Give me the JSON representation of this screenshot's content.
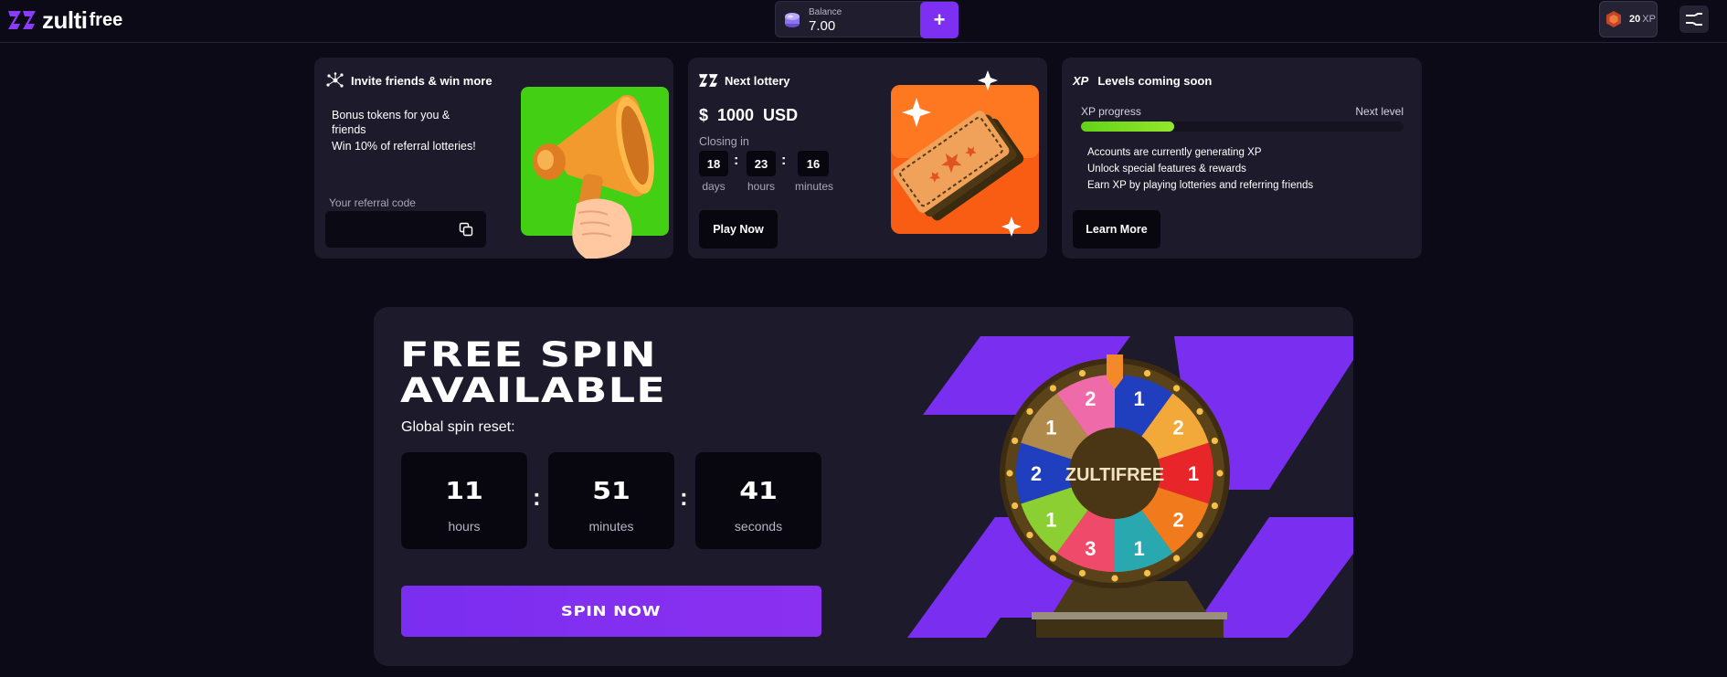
{
  "header": {
    "logo_word": "zulti",
    "logo_free": "free",
    "balance_label": "Balance",
    "balance_value": "7.00",
    "add_label": "+",
    "xp_value": "20",
    "xp_unit": "XP"
  },
  "cards": {
    "invite": {
      "title": "Invite friends & win more",
      "line1": "Bonus tokens for you & friends",
      "line2": "Win 10% of referral lotteries!",
      "ref_label": "Your referral code",
      "ref_value": ""
    },
    "lottery": {
      "title": "Next lottery",
      "prize": "$  1000  USD",
      "closing": "Closing in",
      "days": "18",
      "hours": "23",
      "minutes": "16",
      "days_label": "days",
      "hours_label": "hours",
      "minutes_label": "minutes",
      "button": "Play Now"
    },
    "levels": {
      "badge": "XP",
      "title": "Levels coming soon",
      "progress_label": "XP progress",
      "next_label": "Next level",
      "progress": 0.29,
      "line1": "Accounts are currently generating XP",
      "line2": "Unlock special features & rewards",
      "line3": "Earn XP by playing lotteries and referring friends",
      "button": "Learn More"
    }
  },
  "spin": {
    "title_line1": "FREE SPIN",
    "title_line2": "AVAILABLE",
    "subtitle": "Global spin reset:",
    "hours": "11",
    "minutes": "51",
    "seconds": "41",
    "hours_label": "hours",
    "minutes_label": "minutes",
    "seconds_label": "seconds",
    "button": "SPIN NOW",
    "wheel_label": "ZULTIFREE",
    "wheel_numbers": [
      "1",
      "2",
      "1",
      "2",
      "1",
      "3",
      "1",
      "2",
      "1",
      "2"
    ]
  },
  "colors": {
    "accent": "#7d2ff2",
    "background": "#0b0a16",
    "card": "#1d1b2b",
    "xp_green": "#6fd81c"
  }
}
